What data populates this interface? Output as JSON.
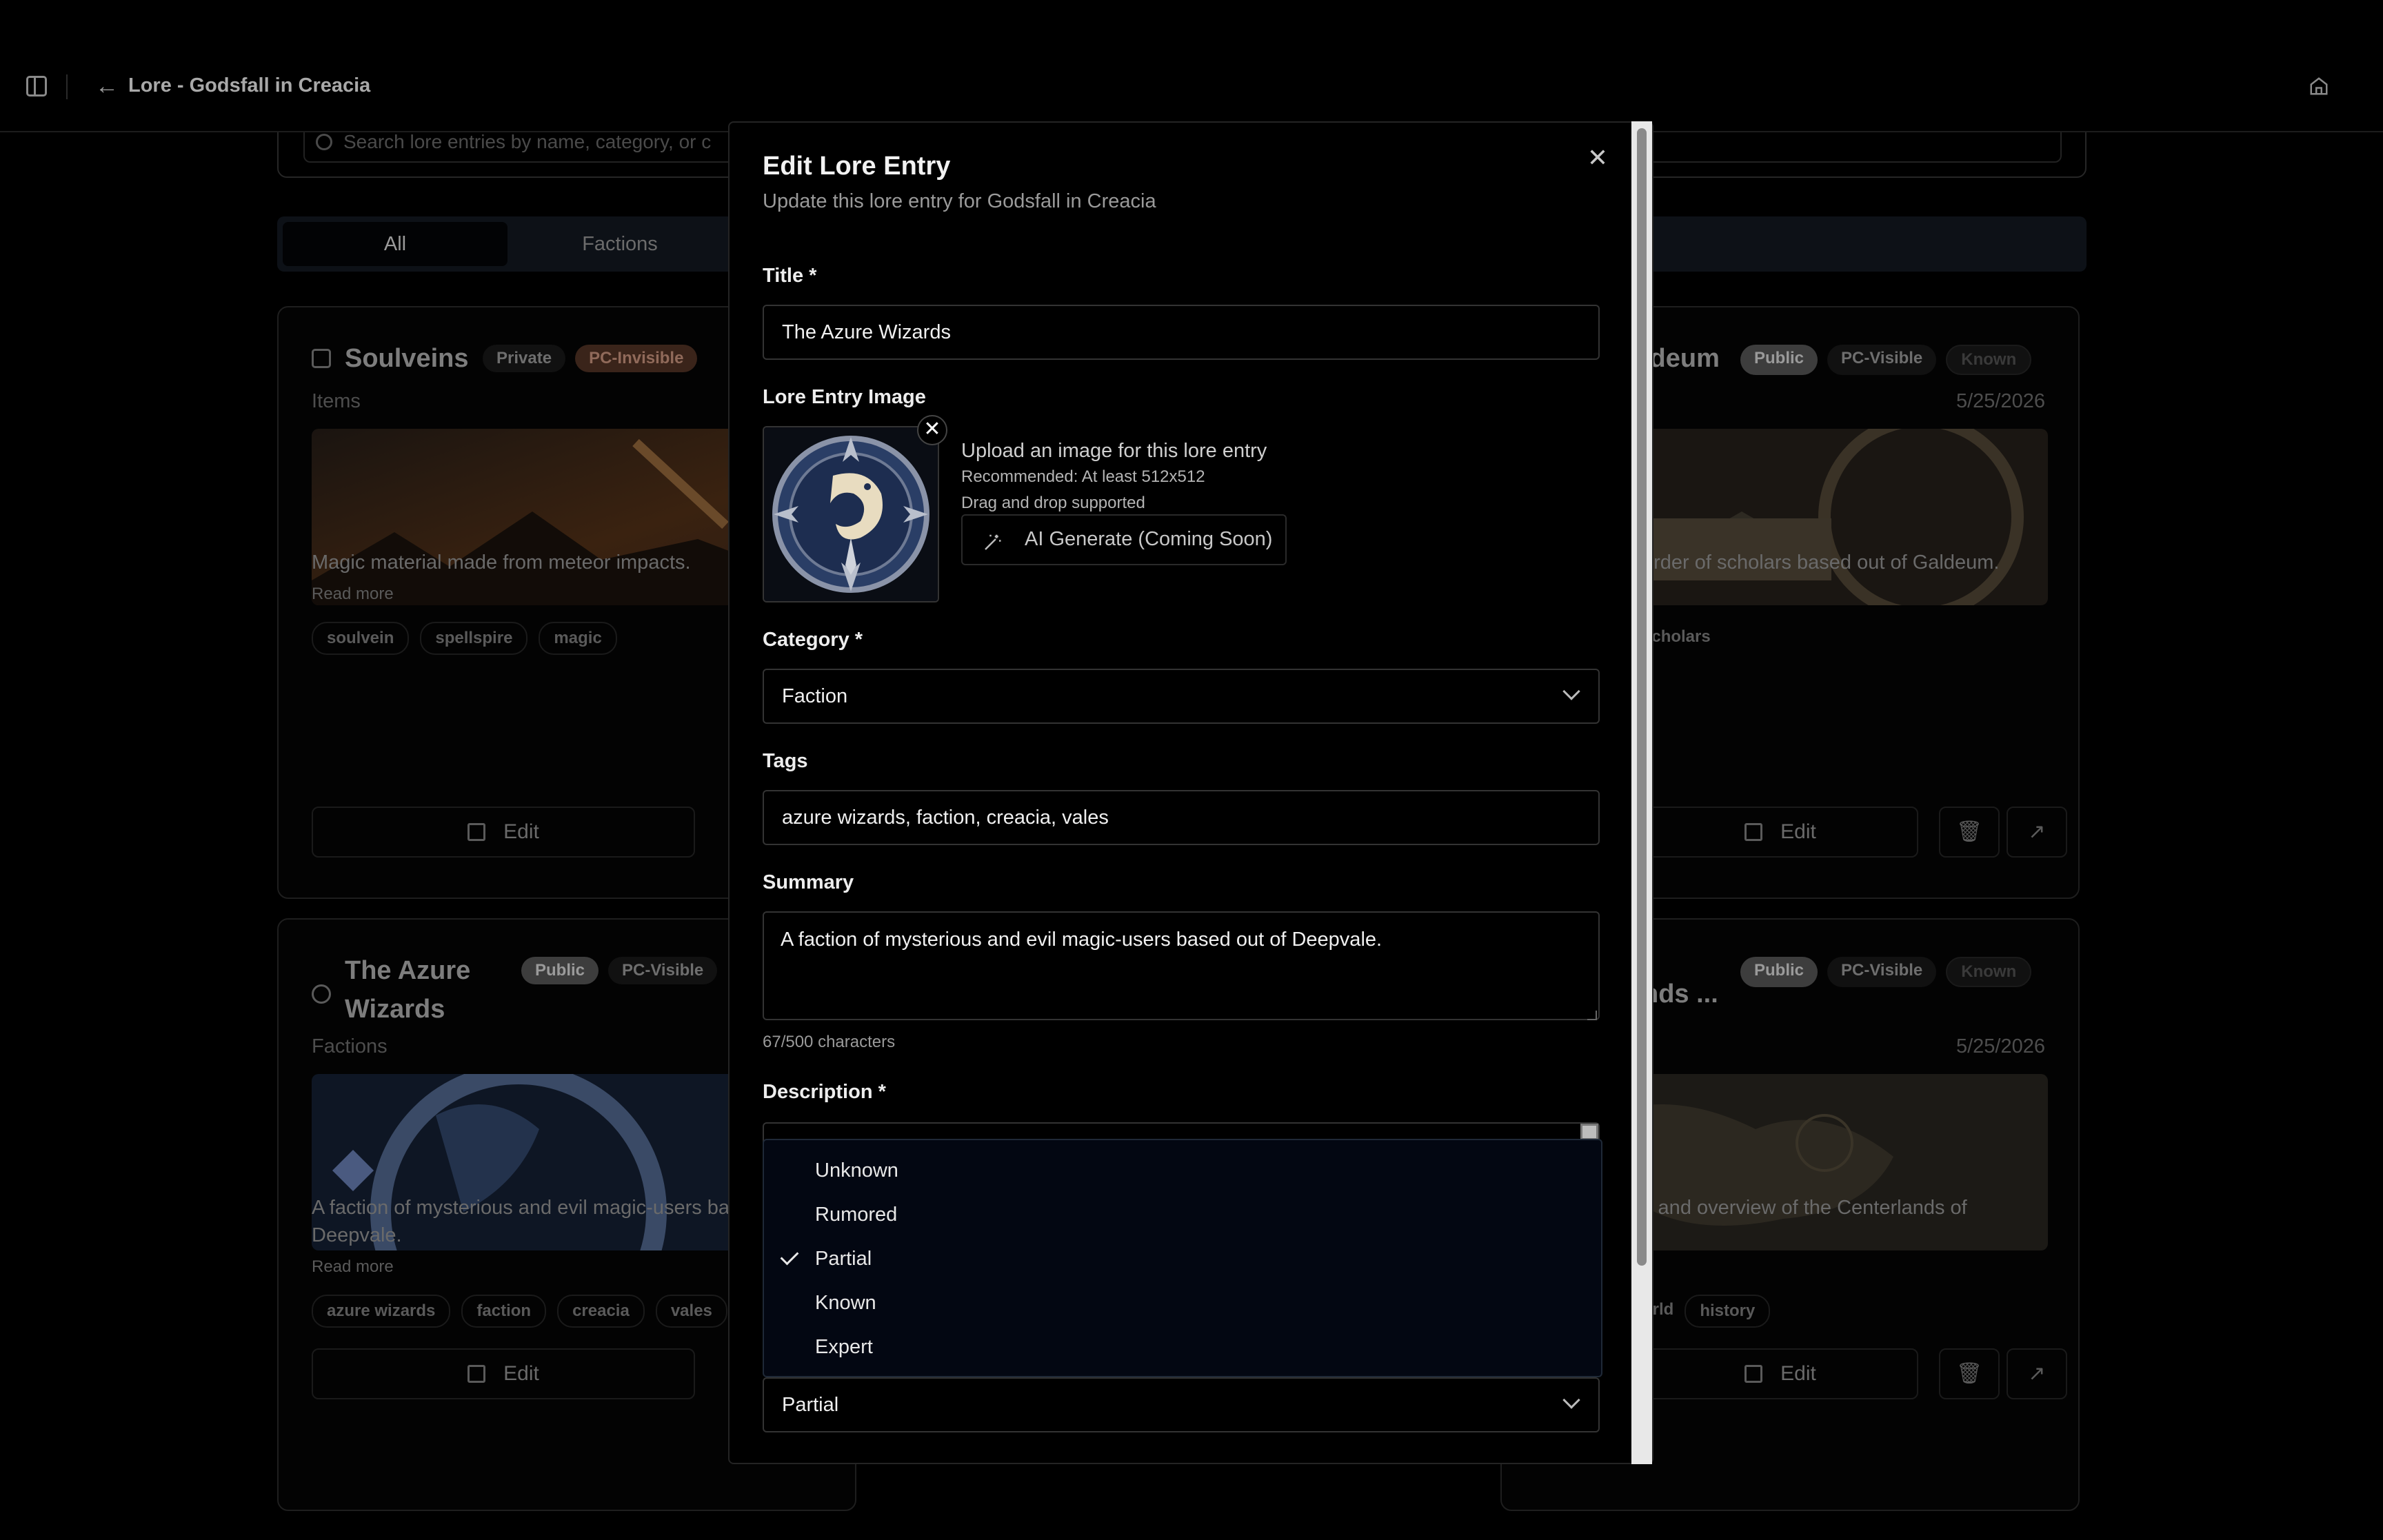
{
  "header": {
    "breadcrumb": "Lore - Godsfall in Creacia",
    "sidebar_icon": "sidebar-toggle-icon",
    "back_icon": "arrow-left-icon",
    "home_icon": "home-icon"
  },
  "background": {
    "search_placeholder": "Search lore entries by name, category, or c",
    "tabs": [
      {
        "label": "All"
      },
      {
        "label": "Factions"
      }
    ],
    "cards": [
      {
        "title": "Soulveins",
        "category": "Items",
        "badges": [
          "Private",
          "PC-Invisible"
        ],
        "summary": "Magic material made from meteor impacts.",
        "read_more": "Read more",
        "tags": [
          "soulvein",
          "spellspire",
          "magic"
        ],
        "edit": "Edit"
      },
      {
        "title": "Galdeum",
        "title_visible": "ldeum",
        "category": "",
        "badges": [
          "Public",
          "PC-Visible",
          "Known"
        ],
        "date": "5/25/2026",
        "summary": "order of scholars based out of Galdeum.",
        "tags": [
          "scholars"
        ],
        "edit": "Edit"
      },
      {
        "title": "The Azure Wizards",
        "category": "Factions",
        "badges": [
          "Public",
          "PC-Visible"
        ],
        "summary": "A faction of mysterious and evil magic-users ba",
        "summary_line2": "Deepvale.",
        "read_more": "Read more",
        "tags": [
          "azure wizards",
          "faction",
          "creacia",
          "vales"
        ],
        "edit": "Edit"
      },
      {
        "title_visible": "nds ...",
        "badges": [
          "Public",
          "PC-Visible",
          "Known"
        ],
        "date": "5/25/2026",
        "summary": "y and overview of the Centerlands of",
        "tags": [
          "orld",
          "history"
        ],
        "edit": "Edit"
      }
    ]
  },
  "modal": {
    "title": "Edit Lore Entry",
    "subtitle": "Update this lore entry for Godsfall in Creacia",
    "title_label": "Title *",
    "title_value": "The Azure Wizards",
    "image_label": "Lore Entry Image",
    "upload_text": "Upload an image for this lore entry",
    "upload_recommend": "Recommended: At least 512x512",
    "upload_drag": "Drag and drop supported",
    "ai_button": "AI Generate (Coming Soon)",
    "category_label": "Category *",
    "category_value": "Faction",
    "tags_label": "Tags",
    "tags_value": "azure wizards, faction, creacia, vales",
    "summary_label": "Summary",
    "summary_value": "A faction of mysterious and evil magic-users based out of Deepvale.",
    "summary_counter": "67/500 characters",
    "description_label": "Description *",
    "knowledge_options": [
      "Unknown",
      "Rumored",
      "Partial",
      "Known",
      "Expert"
    ],
    "knowledge_selected": "Partial",
    "knowledge_value": "Partial"
  }
}
